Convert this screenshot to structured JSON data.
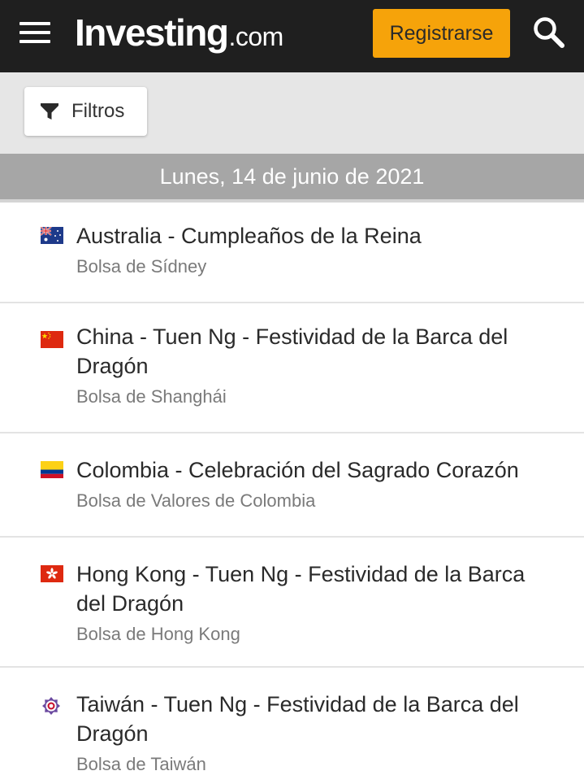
{
  "header": {
    "logo_main": "Investing",
    "logo_sub": ".com",
    "register_label": "Registrarse"
  },
  "filters": {
    "label": "Filtros"
  },
  "date_header": "Lunes, 14 de junio de 2021",
  "colors": {
    "topbar": "#1f1f1f",
    "accent": "#f6a30a",
    "filter_bar": "#e6e6e6",
    "date_header": "#a6a6a6"
  },
  "holidays": [
    {
      "flag": "australia-flag-icon",
      "title": "Australia - Cumpleaños de la Reina",
      "exchange": "Bolsa de Sídney"
    },
    {
      "flag": "china-flag-icon",
      "title": "China - Tuen Ng - Festividad de la Barca del Dragón",
      "exchange": "Bolsa de Shanghái"
    },
    {
      "flag": "colombia-flag-icon",
      "title": "Colombia - Celebración del Sagrado Corazón",
      "exchange": "Bolsa de Valores de Colombia"
    },
    {
      "flag": "hong-kong-flag-icon",
      "title": "Hong Kong - Tuen Ng - Festividad de la Barca del Dragón",
      "exchange": "Bolsa de Hong Kong"
    },
    {
      "flag": "taiwan-flag-icon",
      "title": "Taiwán - Tuen Ng - Festividad de la Barca del Dragón",
      "exchange": "Bolsa de Taiwán"
    }
  ]
}
